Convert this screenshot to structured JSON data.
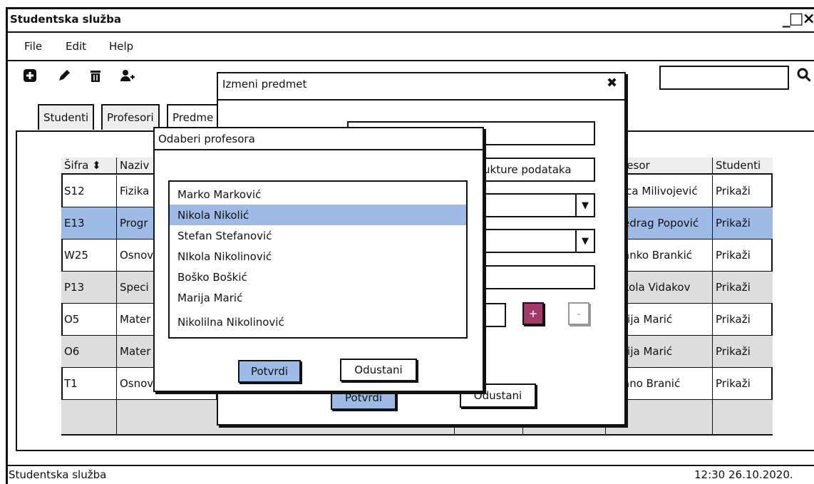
{
  "window": {
    "title": "Studentska služba",
    "controls": "_□×"
  },
  "menu": [
    "File",
    "Edit",
    "Help"
  ],
  "toolbar": {
    "icons": [
      "plus-square-icon",
      "pencil-icon",
      "trash-icon",
      "add-user-icon"
    ],
    "search": {
      "value": "",
      "icon": "search-icon"
    }
  },
  "tabs": [
    "Studenti",
    "Profesori",
    "Predme"
  ],
  "table": {
    "headers": [
      "Šifra ⬍",
      "Naziv",
      "fesor",
      "Studenti"
    ],
    "rows": [
      {
        "code": "S12",
        "name": "Fizika",
        "professor": "ica Milivojević",
        "students": "Prikaži"
      },
      {
        "code": "E13",
        "name": "Progr",
        "professor": "edrag Popović",
        "students": "Prikaži"
      },
      {
        "code": "W25",
        "name": "Osnov",
        "professor": "anko Brankić",
        "students": "Prikaži"
      },
      {
        "code": "P13",
        "name": "Speci",
        "professor": "kola Vidakov",
        "students": "Prikaži"
      },
      {
        "code": "O5",
        "name": "Mater",
        "professor": "rija Marić",
        "students": "Prikaži"
      },
      {
        "code": "O6",
        "name": "Mater",
        "professor": "rija Marić",
        "students": "Prikaži"
      },
      {
        "code": "T1",
        "name": "Osnov",
        "professor": "ano Branić",
        "students": "Prikaži"
      }
    ]
  },
  "edit_dialog": {
    "title": "Izmeni predmet",
    "close": "✖",
    "field2_value": "ukture podataka",
    "add_label": "+",
    "remove_label": "-",
    "confirm": "Potvrdi",
    "cancel": "Odustani"
  },
  "choose_dialog": {
    "title": "Odaberi profesora",
    "professors": [
      "Marko Marković",
      "Nikola Nikolić",
      "Stefan Stefanović",
      "NIkola Nikolinović",
      "Boško Boškić",
      "Marija Marić",
      "Nikolilna Nikolinović"
    ],
    "selected_index": 1,
    "confirm": "Potvrdi",
    "cancel": "Odustani"
  },
  "status": {
    "left": "Studentska služba",
    "right": "12:30 26.10.2020."
  },
  "colors": {
    "selection": "#9dbbe6",
    "accent": "#a3386b",
    "alt_row": "#dddddd"
  }
}
